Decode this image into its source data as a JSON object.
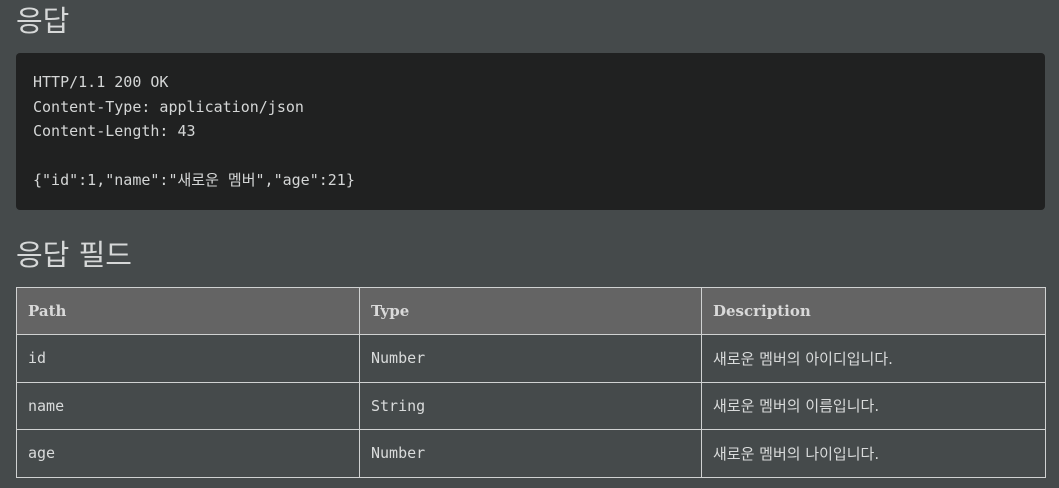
{
  "response": {
    "title": "응답",
    "code_lines": [
      "HTTP/1.1 200 OK",
      "Content-Type: application/json",
      "Content-Length: 43",
      "",
      "{\"id\":1,\"name\":\"새로운 멤버\",\"age\":21}"
    ]
  },
  "fields": {
    "title": "응답 필드",
    "headers": [
      "Path",
      "Type",
      "Description"
    ],
    "rows": [
      {
        "path": "id",
        "type": "Number",
        "description": "새로운 멤버의 아이디입니다."
      },
      {
        "path": "name",
        "type": "String",
        "description": "새로운 멤버의 이름입니다."
      },
      {
        "path": "age",
        "type": "Number",
        "description": "새로운 멤버의 나이입니다."
      }
    ]
  }
}
